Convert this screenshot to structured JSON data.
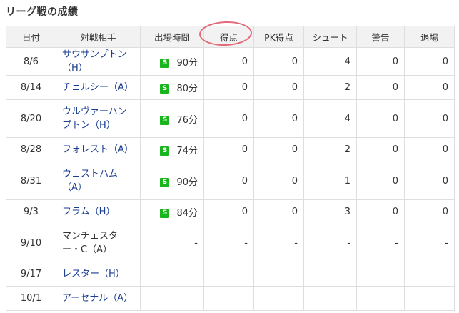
{
  "section_title": "リーグ戦の成績",
  "headers": {
    "date": "日付",
    "opponent": "対戦相手",
    "minutes": "出場時間",
    "goals": "得点",
    "pk_goals": "PK得点",
    "shots": "シュート",
    "yellow": "警告",
    "red": "退場"
  },
  "starter_badge": "S",
  "matches": [
    {
      "date": "8/6",
      "opponent": "サウサンプトン（H）",
      "linked": true,
      "starter": true,
      "minutes": "90分",
      "goals": "0",
      "pk_goals": "0",
      "shots": "4",
      "yellow": "0",
      "red": "0"
    },
    {
      "date": "8/14",
      "opponent": "チェルシー（A）",
      "linked": true,
      "starter": true,
      "minutes": "80分",
      "goals": "0",
      "pk_goals": "0",
      "shots": "2",
      "yellow": "0",
      "red": "0"
    },
    {
      "date": "8/20",
      "opponent": "ウルヴァーハンプトン（H）",
      "linked": true,
      "starter": true,
      "minutes": "76分",
      "goals": "0",
      "pk_goals": "0",
      "shots": "4",
      "yellow": "0",
      "red": "0"
    },
    {
      "date": "8/28",
      "opponent": "フォレスト（A）",
      "linked": true,
      "starter": true,
      "minutes": "74分",
      "goals": "0",
      "pk_goals": "0",
      "shots": "2",
      "yellow": "0",
      "red": "0"
    },
    {
      "date": "8/31",
      "opponent": "ウェストハム（A）",
      "linked": true,
      "starter": true,
      "minutes": "90分",
      "goals": "0",
      "pk_goals": "0",
      "shots": "1",
      "yellow": "0",
      "red": "0"
    },
    {
      "date": "9/3",
      "opponent": "フラム（H）",
      "linked": true,
      "starter": true,
      "minutes": "84分",
      "goals": "0",
      "pk_goals": "0",
      "shots": "3",
      "yellow": "0",
      "red": "0"
    },
    {
      "date": "9/10",
      "opponent": "マンチェスター・C（A）",
      "linked": false,
      "starter": false,
      "minutes": "-",
      "goals": "-",
      "pk_goals": "-",
      "shots": "-",
      "yellow": "-",
      "red": "-"
    },
    {
      "date": "9/17",
      "opponent": "レスター（H）",
      "linked": true,
      "starter": false,
      "minutes": "",
      "goals": "",
      "pk_goals": "",
      "shots": "",
      "yellow": "",
      "red": ""
    },
    {
      "date": "10/1",
      "opponent": "アーセナル（A）",
      "linked": true,
      "starter": false,
      "minutes": "",
      "goals": "",
      "pk_goals": "",
      "shots": "",
      "yellow": "",
      "red": ""
    }
  ],
  "colors": {
    "starter_badge": "#19b51d",
    "link": "#1a3d8f",
    "header_bg": "#f2f2f2",
    "annotation_circle": "#e46a7a"
  }
}
